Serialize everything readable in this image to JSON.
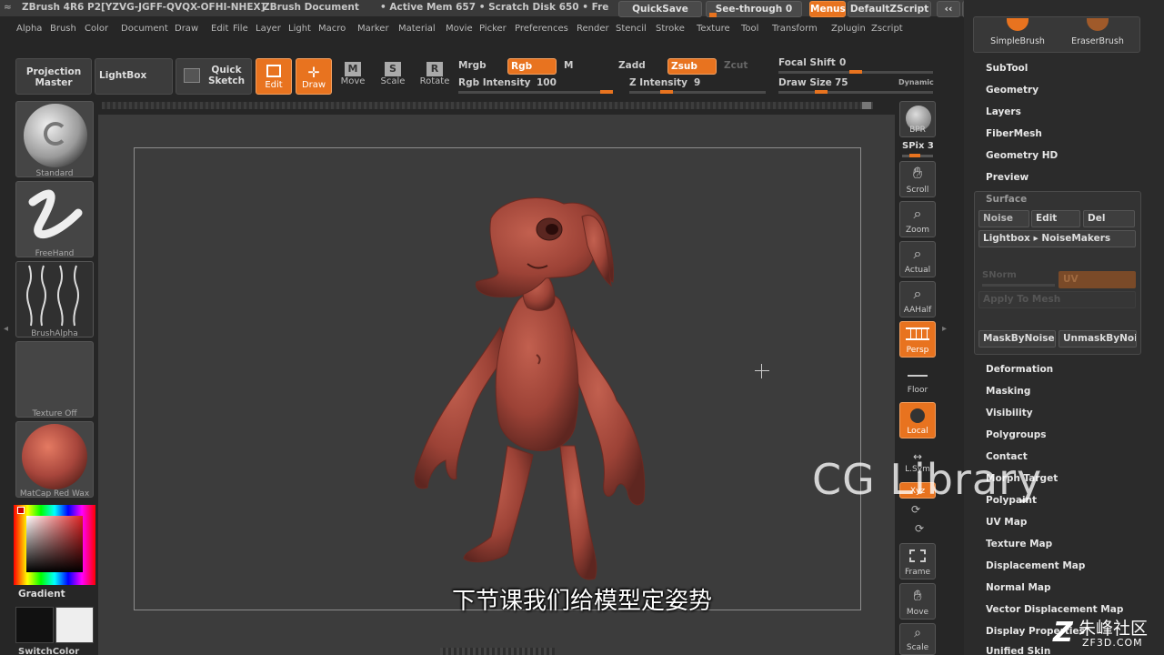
{
  "titlebar": {
    "app": "ZBrush 4R6 P2[YZVG-JGFF-QVQX-OFHI-NHEX]",
    "document": "ZBrush Document",
    "mem": "• Active Mem 657 • Scratch Disk 650 • Fre",
    "quicksave": "QuickSave",
    "seethrough": "See-through  0",
    "menus": "Menus",
    "script": "DefaultZScript"
  },
  "menubar": [
    "Alpha",
    "Brush",
    "Color",
    "Document",
    "Draw",
    "Edit",
    "File",
    "Layer",
    "Light",
    "Macro",
    "Marker",
    "Material",
    "Movie",
    "Picker",
    "Preferences",
    "Render",
    "Stencil",
    "Stroke",
    "Texture",
    "Tool",
    "Transform",
    "Zplugin",
    "Zscript"
  ],
  "toolbar": {
    "projection_master": "Projection Master",
    "lightbox": "LightBox",
    "quick_sketch": "Quick Sketch",
    "edit": "Edit",
    "draw": "Draw",
    "move": "Move",
    "scale": "Scale",
    "rotate": "Rotate",
    "mrgb": "Mrgb",
    "rgb": "Rgb",
    "m": "M",
    "zadd": "Zadd",
    "zsub": "Zsub",
    "zcut": "Zcut",
    "rgb_intensity_label": "Rgb Intensity",
    "rgb_intensity": "100",
    "z_intensity_label": "Z Intensity",
    "z_intensity": "9",
    "focal_shift_label": "Focal Shift",
    "focal_shift": "0",
    "draw_size_label": "Draw Size",
    "draw_size": "75",
    "dynamic": "Dynamic"
  },
  "leftshelf": {
    "brush": "Standard",
    "stroke": "FreeHand",
    "alpha": "BrushAlpha",
    "texture": "Texture Off",
    "material": "MatCap Red Wax",
    "gradient": "Gradient",
    "switchcolor": "SwitchColor"
  },
  "rightshelf": {
    "bpr": "BPR",
    "spix": "SPix 3",
    "scroll": "Scroll",
    "zoom": "Zoom",
    "actual": "Actual",
    "aahalf": "AAHalf",
    "persp": "Persp",
    "floor": "Floor",
    "local": "Local",
    "lsym": "L.Sym",
    "xyz": "Xyz",
    "frame": "Frame",
    "move": "Move",
    "scale": "Scale"
  },
  "palette": {
    "brushes": [
      "SimpleBrush",
      "EraserBrush"
    ],
    "items_top": [
      "SubTool",
      "Geometry",
      "Layers",
      "FiberMesh",
      "Geometry HD",
      "Preview"
    ],
    "surface": "Surface",
    "noise": "Noise",
    "edit": "Edit",
    "del": "Del",
    "lightbox_noise": "Lightbox ▸ NoiseMakers",
    "snorm": "SNorm",
    "uv": "UV",
    "apply": "Apply To Mesh",
    "mask_by_noise": "MaskByNoise",
    "unmask_by_noise": "UnmaskByNois",
    "items_bottom": [
      "Deformation",
      "Masking",
      "Visibility",
      "Polygroups",
      "Contact",
      "Morph Target",
      "Polypaint",
      "UV Map",
      "Texture Map",
      "Displacement Map",
      "Normal Map",
      "Vector Displacement Map",
      "Display Properties",
      "Unified Skin"
    ]
  },
  "subtitle": "下节课我们给模型定姿势",
  "watermark": "CG Library",
  "logo": {
    "cn": "朱峰社区",
    "url": "ZF3D.COM"
  },
  "colors": {
    "accent": "#e8731f",
    "model": "#a8463c"
  }
}
